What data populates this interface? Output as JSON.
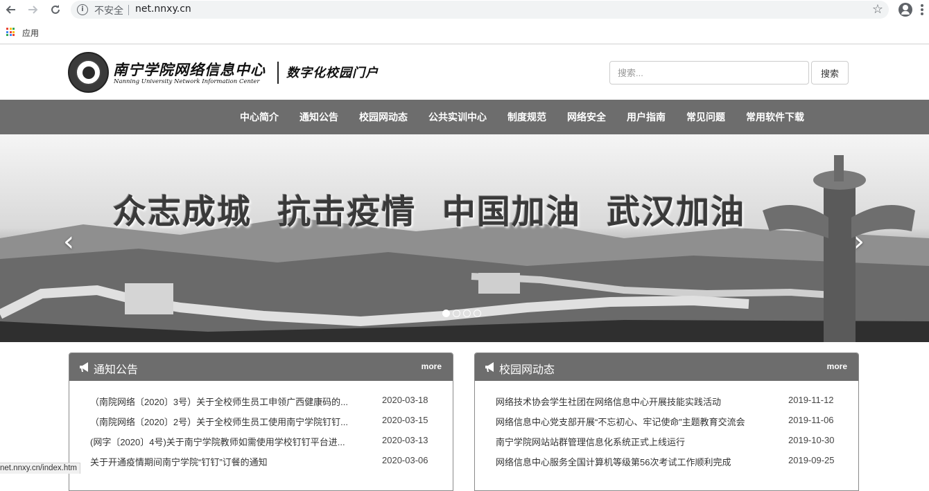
{
  "browser": {
    "security_label": "不安全",
    "url": "net.nnxy.cn",
    "bookmark_apps_label": "应用",
    "status_url": "net.nnxy.cn/index.htm"
  },
  "header": {
    "brand_cn": "南宁学院网络信息中心",
    "brand_en": "Nanning University Network Information Center",
    "portal_title": "数字化校园门户",
    "search_placeholder": "搜索...",
    "search_button": "搜索"
  },
  "nav": {
    "items": [
      "中心简介",
      "通知公告",
      "校园网动态",
      "公共实训中心",
      "制度规范",
      "网络安全",
      "用户指南",
      "常见问题",
      "常用软件下载"
    ]
  },
  "banner": {
    "slogan": "众志成城  抗击疫情  中国加油  武汉加油",
    "prev": "‹",
    "next": "›",
    "slides": 4,
    "active_slide": 1
  },
  "notices": {
    "title": "通知公告",
    "more": "more",
    "items": [
      {
        "title": "（南院网络〔2020〕3号）关于全校师生员工申领广西健康码的...",
        "date": "2020-03-18"
      },
      {
        "title": "（南院网络〔2020〕2号）关于全校师生员工使用南宁学院钉钉...",
        "date": "2020-03-15"
      },
      {
        "title": "(网字〔2020〕4号)关于南宁学院教师如需使用学校钉钉平台进...",
        "date": "2020-03-13"
      },
      {
        "title": "关于开通疫情期间南宁学院“钉钉”订餐的通知",
        "date": "2020-03-06"
      }
    ]
  },
  "news": {
    "title": "校园网动态",
    "more": "more",
    "items": [
      {
        "title": "网络技术协会学生社团在网络信息中心开展技能实践活动",
        "date": "2019-11-12"
      },
      {
        "title": "网络信息中心党支部开展“不忘初心、牢记使命”主题教育交流会",
        "date": "2019-11-06"
      },
      {
        "title": "南宁学院网站站群管理信息化系统正式上线运行",
        "date": "2019-10-30"
      },
      {
        "title": "网络信息中心服务全国计算机等级第56次考试工作顺利完成",
        "date": "2019-09-25"
      }
    ]
  },
  "colors": {
    "nav_bg": "#6d6d6d",
    "panel_head_bg": "#6d6d6d"
  }
}
